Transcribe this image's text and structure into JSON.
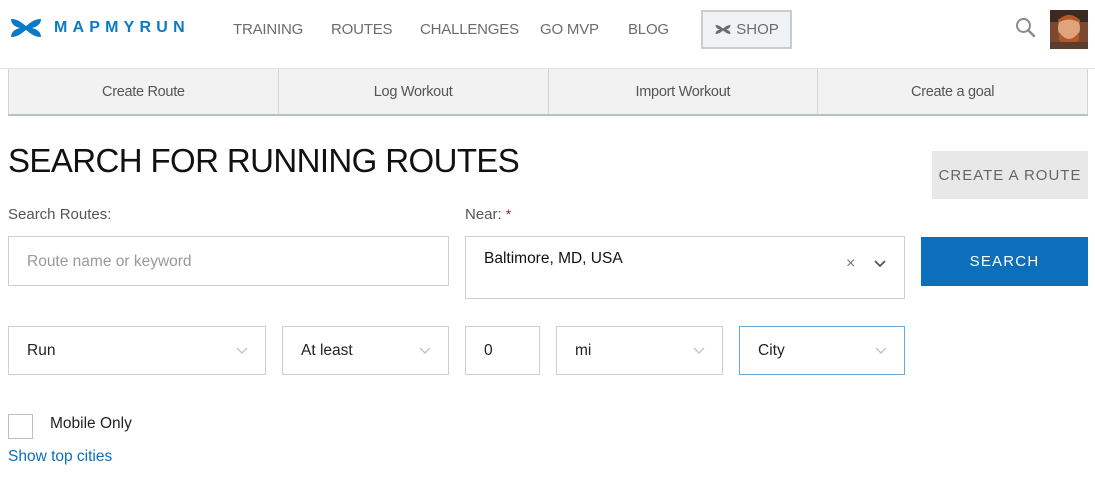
{
  "brand": {
    "name": "MAPMYRUN",
    "accent": "#0a7ac7"
  },
  "topnav": {
    "links": [
      "TRAINING",
      "ROUTES",
      "CHALLENGES",
      "GO MVP",
      "BLOG"
    ],
    "shop_label": "SHOP",
    "search_icon": "search-icon"
  },
  "subnav": {
    "items": [
      "Create Route",
      "Log Workout",
      "Import Workout",
      "Create a goal"
    ]
  },
  "page": {
    "title": "SEARCH FOR RUNNING ROUTES",
    "create_route_label": "CREATE A ROUTE"
  },
  "search": {
    "routes_label": "Search Routes:",
    "routes_placeholder": "Route name or keyword",
    "near_label": "Near:",
    "near_required": "*",
    "near_value": "Baltimore, MD, USA",
    "clear_glyph": "×",
    "search_label": "SEARCH",
    "search_color": "#0c6fbc"
  },
  "filters": {
    "activity": "Run",
    "comparator": "At least",
    "distance": "0",
    "unit": "mi",
    "location_type": "City"
  },
  "options": {
    "mobile_only_label": "Mobile Only",
    "show_top_cities": "Show top cities"
  }
}
